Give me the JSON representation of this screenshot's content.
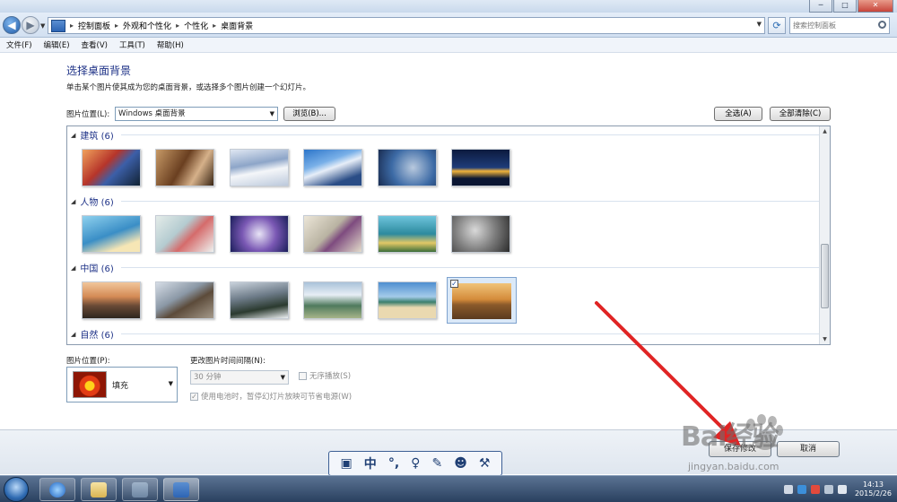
{
  "window": {
    "minimize": "─",
    "maximize": "□",
    "close": "✕"
  },
  "nav": {
    "breadcrumb": [
      "控制面板",
      "外观和个性化",
      "个性化",
      "桌面背景"
    ],
    "search_placeholder": "搜索控制面板"
  },
  "menu": [
    "文件(F)",
    "编辑(E)",
    "查看(V)",
    "工具(T)",
    "帮助(H)"
  ],
  "page": {
    "title": "选择桌面背景",
    "description": "单击某个图片使其成为您的桌面背景，或选择多个图片创建一个幻灯片。",
    "location_label": "图片位置(L):",
    "location_value": "Windows 桌面背景",
    "browse_label": "浏览(B)...",
    "select_all_label": "全选(A)",
    "clear_all_label": "全部清除(C)"
  },
  "groups": [
    {
      "name": "建筑 (6)",
      "count": 6
    },
    {
      "name": "人物 (6)",
      "count": 6
    },
    {
      "name": "中国 (6)",
      "count": 6,
      "selected_index": 5
    },
    {
      "name": "自然 (6)",
      "count": 6
    }
  ],
  "options": {
    "position_label": "图片位置(P):",
    "position_value": "填充",
    "interval_label": "更改图片时间间隔(N):",
    "interval_value": "30 分钟",
    "shuffle_label": "无序播放(S)",
    "battery_label": "使用电池时，暂停幻灯片放映可节省电源(W)",
    "shuffle_checked": false,
    "battery_checked": true
  },
  "footer": {
    "save_label": "保存修改",
    "cancel_label": "取消"
  },
  "lang_bar": [
    "中",
    "°,",
    "✎"
  ],
  "taskbar": {
    "time": "14:13",
    "date": "2015/2/26"
  },
  "watermark": {
    "text": "Bai经验",
    "url": "jingyan.baidu.com"
  },
  "colors": {
    "accent": "#1e3287",
    "arrow": "#e02424",
    "selection": "#dbe9f8"
  }
}
